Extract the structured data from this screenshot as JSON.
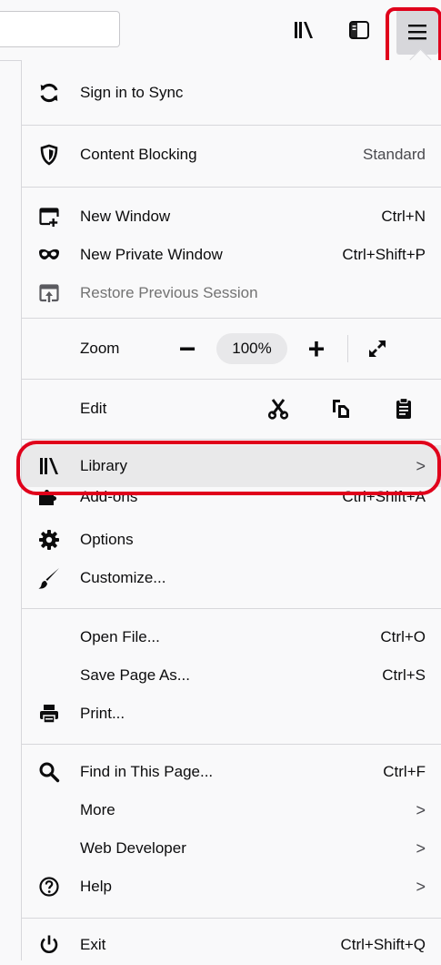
{
  "menu": {
    "sign_in": "Sign in to Sync",
    "content_blocking": "Content Blocking",
    "content_blocking_value": "Standard",
    "new_window": "New Window",
    "new_window_shortcut": "Ctrl+N",
    "new_private_window": "New Private Window",
    "new_private_window_shortcut": "Ctrl+Shift+P",
    "restore_session": "Restore Previous Session",
    "zoom": "Zoom",
    "zoom_level": "100%",
    "edit": "Edit",
    "library": "Library",
    "addons": "Add-ons",
    "addons_shortcut": "Ctrl+Shift+A",
    "options": "Options",
    "customize": "Customize...",
    "open_file": "Open File...",
    "open_file_shortcut": "Ctrl+O",
    "save_page": "Save Page As...",
    "save_page_shortcut": "Ctrl+S",
    "print": "Print...",
    "find": "Find in This Page...",
    "find_shortcut": "Ctrl+F",
    "more": "More",
    "web_developer": "Web Developer",
    "help": "Help",
    "exit": "Exit",
    "exit_shortcut": "Ctrl+Shift+Q",
    "chevron": ">"
  },
  "zoom_controls": {
    "minus": "−",
    "plus": "+"
  },
  "icons": {
    "sync": "sync-icon",
    "shield": "shield-icon",
    "new_window": "new-window-icon",
    "private": "private-mask-icon",
    "restore": "restore-session-icon",
    "fullscreen": "fullscreen-icon",
    "cut": "cut-icon",
    "copy": "copy-icon",
    "paste": "paste-icon",
    "library": "library-icon",
    "addons": "puzzle-icon",
    "options": "gear-icon",
    "customize": "brush-icon",
    "print": "printer-icon",
    "find": "search-icon",
    "help": "help-icon",
    "exit": "power-icon"
  },
  "colors": {
    "highlight": "#e0001b",
    "panel_bg": "#f9f9fa"
  }
}
